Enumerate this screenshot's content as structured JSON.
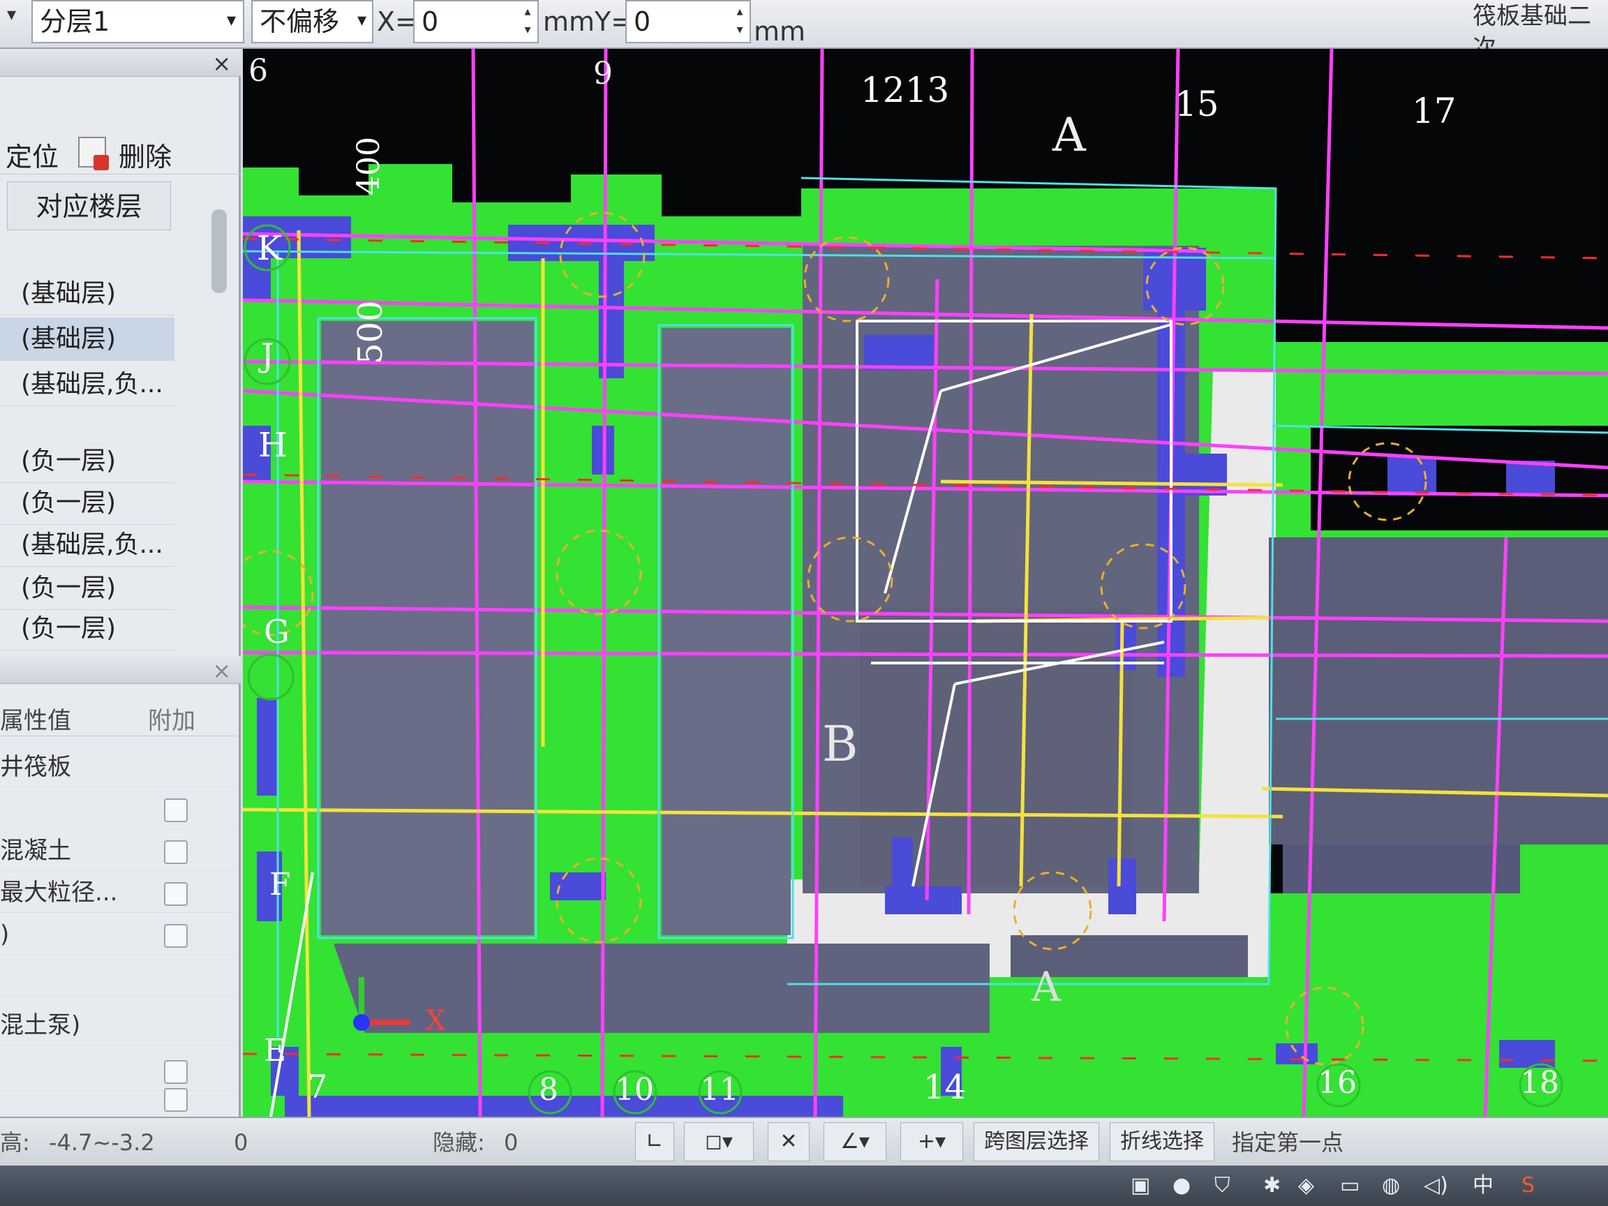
{
  "toolbar": {
    "layer_select": "分层1",
    "offset_select": "不偏移",
    "x_label": "X=",
    "x_value": "0",
    "y_label": "mmY=",
    "y_value": "0",
    "unit": "mm",
    "right_text": "筏板基础二次"
  },
  "layer_panel": {
    "locate_label": "定位",
    "delete_label": "删除",
    "column_header": "对应楼层",
    "rows": [
      "(基础层)",
      "(基础层)",
      "(基础层,负...",
      "(负一层)",
      "(负一层)",
      "(基础层,负...",
      "(负一层)",
      "(负一层)"
    ]
  },
  "property_panel": {
    "col_value": "属性值",
    "col_extra": "附加",
    "rows": [
      {
        "label": "井筏板",
        "check": false
      },
      {
        "label": "",
        "check": true
      },
      {
        "label": "混凝土",
        "check": true
      },
      {
        "label": "最大粒径...",
        "check": true
      },
      {
        "label": ")",
        "check": true
      },
      {
        "label": "",
        "check": false
      },
      {
        "label": "混土泵)",
        "check": false
      },
      {
        "label": "",
        "check": true
      },
      {
        "label": "",
        "check": true
      }
    ]
  },
  "canvas": {
    "axis_top": [
      "6",
      "9",
      "1213",
      "15",
      "17"
    ],
    "axis_bottom": [
      "7",
      "8",
      "10",
      "11",
      "14",
      "16",
      "18"
    ],
    "axis_left": [
      "K",
      "J",
      "H",
      "G",
      "F",
      "E"
    ],
    "dims": [
      "400",
      "500"
    ],
    "labels": [
      "A",
      "B",
      "A"
    ],
    "origin_x": "X",
    "colors": {
      "slab": "#33e233",
      "beam": "#4a4bd8",
      "axis": "#ff40ff",
      "yellow": "#f5e23c",
      "cyan": "#4fe0e6",
      "grey": "#6a6d88"
    }
  },
  "status": {
    "elev_label": "高:",
    "elev_value": "-4.7~-3.2",
    "zero": "0",
    "hidden_label": "隐藏:",
    "hidden_value": "0",
    "cross_layer": "跨图层选择",
    "polyline": "折线选择",
    "first_point": "指定第一点"
  },
  "taskbar": {
    "ime": "中"
  }
}
